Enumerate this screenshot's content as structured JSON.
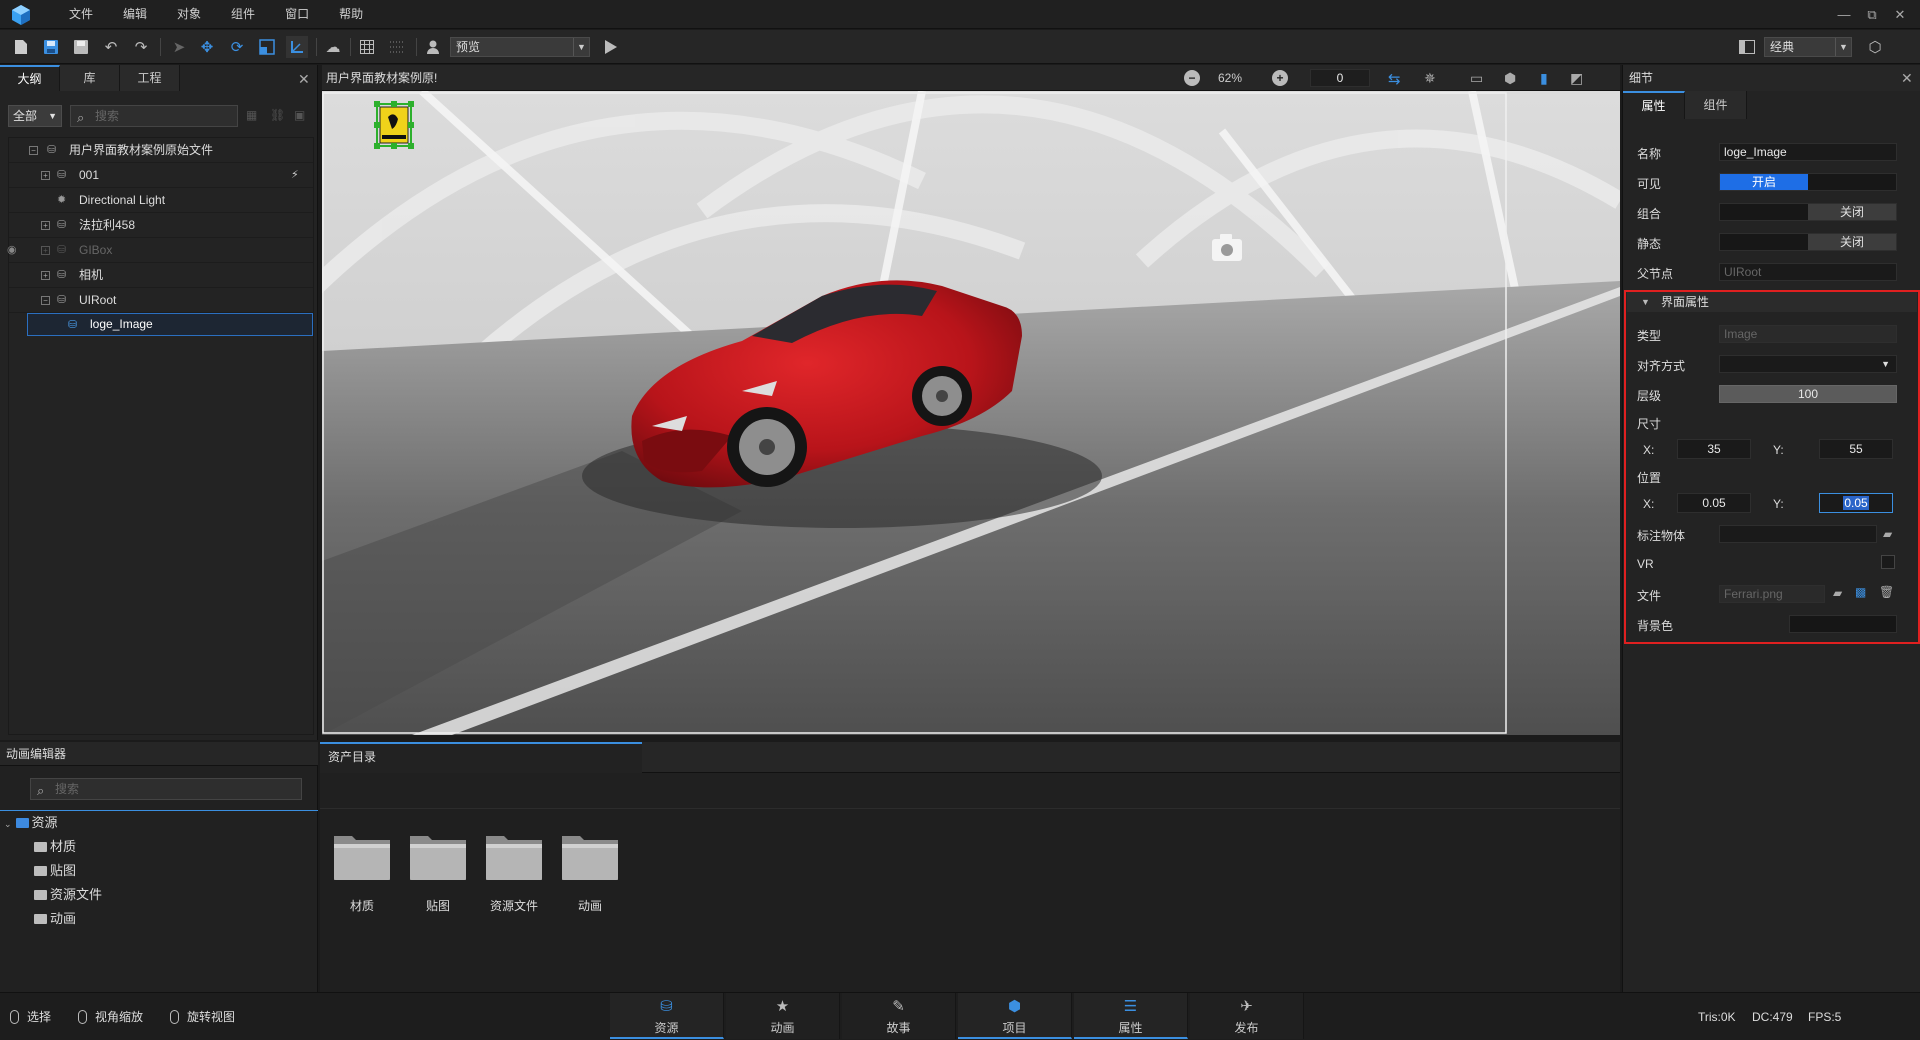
{
  "menubar": {
    "items": [
      "文件",
      "编辑",
      "对象",
      "组件",
      "窗口",
      "帮助"
    ],
    "window_buttons": [
      "—",
      "⧉",
      "✕"
    ]
  },
  "toolbar": {
    "mode_combo": "预览",
    "layout_combo": "经典"
  },
  "outline": {
    "tabs": [
      "大纲",
      "库",
      "工程"
    ],
    "filter": "全部",
    "search_placeholder": "搜索",
    "tree": [
      {
        "label": "用户界面教材案例原始文件",
        "depth": 0
      },
      {
        "label": "001",
        "depth": 1
      },
      {
        "label": "Directional Light",
        "depth": 1
      },
      {
        "label": "法拉利458",
        "depth": 1
      },
      {
        "label": "GIBox",
        "depth": 1
      },
      {
        "label": "相机",
        "depth": 1
      },
      {
        "label": "UIRoot",
        "depth": 1
      },
      {
        "label": "loge_Image",
        "depth": 2
      }
    ]
  },
  "viewport": {
    "title": "用户界面教材案例原!",
    "zoom": "62%",
    "frame": "0"
  },
  "details": {
    "title": "细节",
    "tabs": [
      "属性",
      "组件"
    ],
    "name_label": "名称",
    "name_value": "loge_Image",
    "visible_label": "可见",
    "visible_on": "开启",
    "group_label": "组合",
    "group_off": "关闭",
    "static_label": "静态",
    "static_off": "关闭",
    "parent_label": "父节点",
    "parent_value": "UIRoot",
    "section": "界面属性",
    "type_label": "类型",
    "type_value": "Image",
    "align_label": "对齐方式",
    "layer_label": "层级",
    "layer_value": "100",
    "size_label": "尺寸",
    "size_x": "35",
    "size_y": "55",
    "pos_label": "位置",
    "pos_x": "0.05",
    "pos_y": "0.05",
    "x_label": "X:",
    "y_label": "Y:",
    "mark_label": "标注物体",
    "vr_label": "VR",
    "file_label": "文件",
    "file_value": "Ferrari.png",
    "bg_label": "背景色"
  },
  "anim": {
    "title": "动画编辑器",
    "search_placeholder": "搜索",
    "root": "资源",
    "children": [
      "材质",
      "贴图",
      "资源文件",
      "动画"
    ]
  },
  "assets": {
    "tab": "资产目录",
    "folders": [
      "材质",
      "贴图",
      "资源文件",
      "动画"
    ]
  },
  "status": {
    "hints": [
      "选择",
      "视角缩放",
      "旋转视图"
    ],
    "tabs": [
      "资源",
      "动画",
      "故事",
      "项目",
      "属性",
      "发布"
    ],
    "tris": "Tris:0K",
    "dc": "DC:479",
    "fps": "FPS:5"
  }
}
